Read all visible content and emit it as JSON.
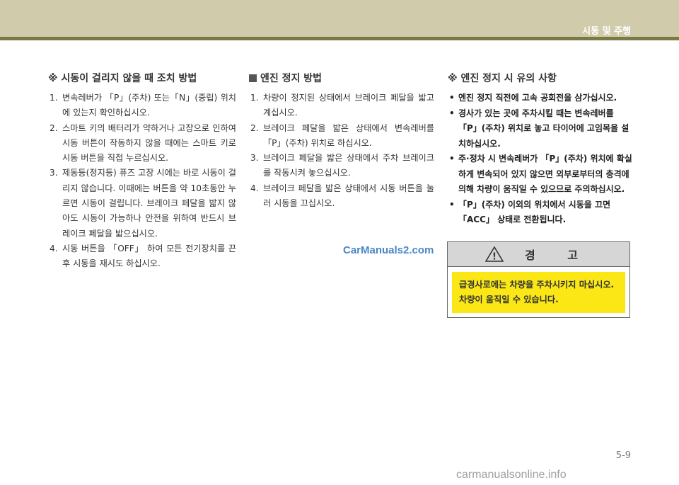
{
  "header": {
    "section_title": "시동 및 주행"
  },
  "col1": {
    "title": "※ 시동이 걸리지 않을 때 조치 방법",
    "items": [
      {
        "num": "1.",
        "text": "변속레버가 「P」(주차) 또는「N」(중립) 위치에 있는지 확인하십시오."
      },
      {
        "num": "2.",
        "text": "스마트 키의 배터리가 약하거나 고장으로 인하여 시동 버튼이 작동하지 않을 때에는 스마트 키로 시동 버튼을 직접 누르십시오."
      },
      {
        "num": "3.",
        "text": "제동등(정지등) 퓨즈 고장 시에는 바로 시동이 걸리지 않습니다. 이때에는 버튼을 약 10초동안 누르면 시동이 걸립니다. 브레이크 페달을 밟지 않아도 시동이 가능하나 안전을 위하여 반드시 브레이크 페달을 밟으십시오."
      },
      {
        "num": "4.",
        "text": "시동 버튼을 「OFF」 하여 모든 전기장치를 끈 후 시동을 재시도 하십시오."
      }
    ]
  },
  "col2": {
    "title": "엔진 정지 방법",
    "items": [
      {
        "num": "1.",
        "text": "차량이 정지된 상태에서 브레이크 페달을 밟고 계십시오."
      },
      {
        "num": "2.",
        "text": "브레이크 페달을 밟은 상태에서 변속레버를 「P」(주차) 위치로 하십시오."
      },
      {
        "num": "3.",
        "text": "브레이크 페달을 밟은 상태에서 주차 브레이크를 작동시켜 놓으십시오."
      },
      {
        "num": "4.",
        "text": "브레이크 페달을 밟은 상태에서 시동 버튼을 눌러 시동을 끄십시오."
      }
    ]
  },
  "col3": {
    "title": "※ 엔진 정지 시 유의 사항",
    "bullets": [
      {
        "dot": "•",
        "text": "엔진 정지 직전에 고속 공회전을 삼가십시오."
      },
      {
        "dot": "•",
        "text": "경사가 있는 곳에 주차시킬 때는 변속레버를 「P」(주차) 위치로 놓고 타이어에 고임목을 설치하십시오."
      },
      {
        "dot": "•",
        "text": "주·정차 시 변속레버가 「P」(주차) 위치에 확실하게 변속되어 있지 않으면 외부로부터의 충격에 의해 차량이 움직일 수 있으므로 주의하십시오."
      },
      {
        "dot": "•",
        "text": "「P」(주차) 이외의 위치에서 시동을 끄면 「ACC」 상태로 전환됩니다."
      }
    ]
  },
  "warning": {
    "icon_symbol": "!",
    "title": "경 고",
    "lines": [
      "급경사로에는 차량을 주차시키지 마십시오.",
      "차량이 움직일 수 있습니다."
    ]
  },
  "watermark": "CarManuals2.com",
  "page_number": "5-9",
  "footer_brand": "carmanualsonline.info"
}
